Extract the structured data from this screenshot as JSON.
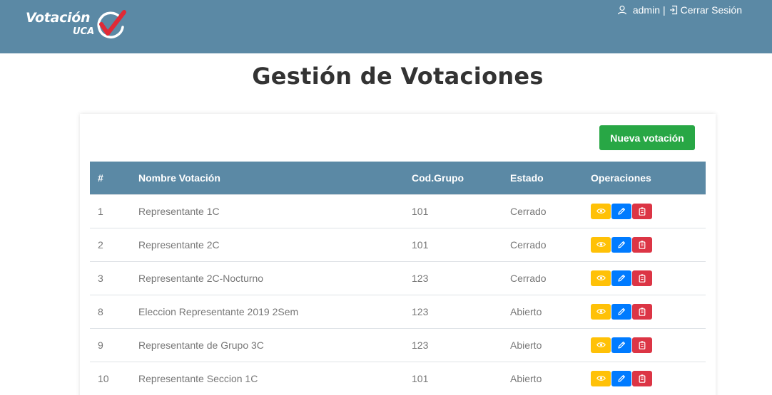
{
  "brand": {
    "name": "Votación",
    "sub": "UCA"
  },
  "user_nav": {
    "username": "admin",
    "separator": "|",
    "logout_label": "Cerrar Sesión"
  },
  "page": {
    "title": "Gestión de Votaciones"
  },
  "actions": {
    "new_vote_label": "Nueva votación"
  },
  "table": {
    "headers": [
      "#",
      "Nombre Votación",
      "Cod.Grupo",
      "Estado",
      "Operaciones"
    ],
    "rows": [
      {
        "num": "1",
        "name": "Representante 1C",
        "cod": "101",
        "estado": "Cerrado"
      },
      {
        "num": "2",
        "name": "Representante 2C",
        "cod": "101",
        "estado": "Cerrado"
      },
      {
        "num": "3",
        "name": "Representante 2C-Nocturno",
        "cod": "123",
        "estado": "Cerrado"
      },
      {
        "num": "8",
        "name": "Eleccion Representante 2019 2Sem",
        "cod": "123",
        "estado": "Abierto"
      },
      {
        "num": "9",
        "name": "Representante de Grupo 3C",
        "cod": "123",
        "estado": "Abierto"
      },
      {
        "num": "10",
        "name": "Representante Seccion 1C",
        "cod": "101",
        "estado": "Abierto"
      }
    ],
    "operations": [
      {
        "icon": "eye-icon",
        "color": "#ffc107"
      },
      {
        "icon": "pencil-icon",
        "color": "#007bff"
      },
      {
        "icon": "trash-icon",
        "color": "#dc3545"
      }
    ]
  },
  "colors": {
    "header": "#5b89a5",
    "success": "#28a745",
    "logo_check": "#e02a36"
  }
}
